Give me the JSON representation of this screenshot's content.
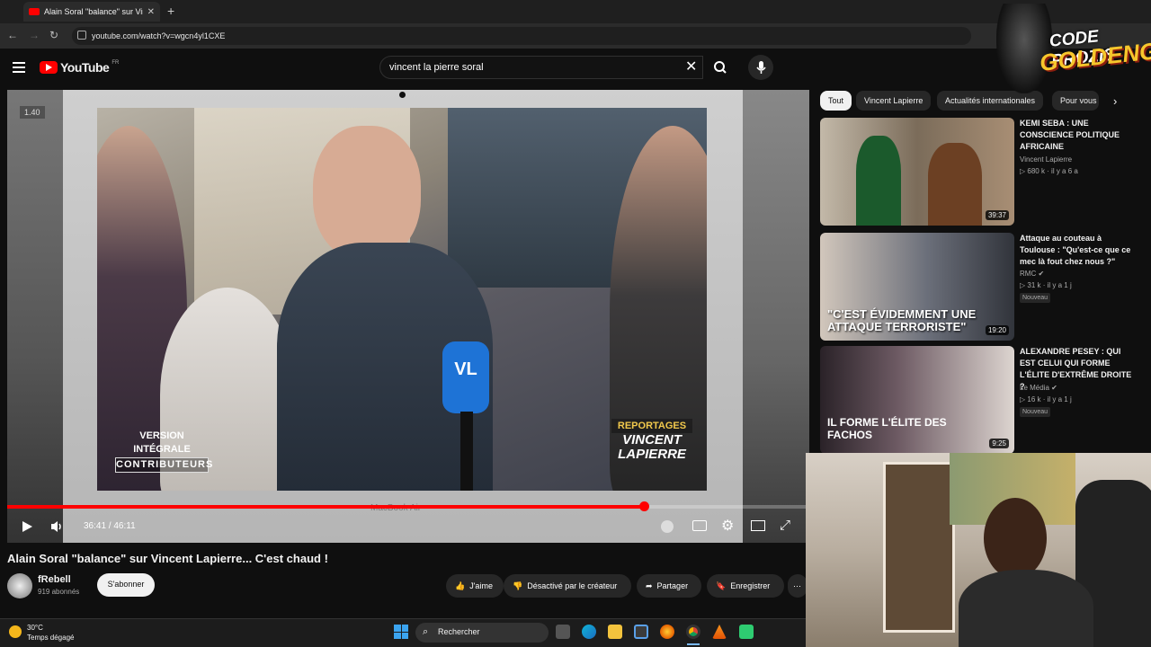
{
  "browser": {
    "tab_title": "Alain Soral \"balance\" sur Vincent Lapierre... C'est chaud ! - YouTube",
    "url": "youtube.com/watch?v=wgcn4yl1CXE"
  },
  "youtube": {
    "logo_text": "YouTube",
    "country": "FR",
    "search_value": "vincent la pierre soral"
  },
  "player": {
    "speed_label": "1.40",
    "time": "36:41 / 46:11",
    "progress": 0.794,
    "overlay_left_1": "VERSION INTÉGRALE",
    "overlay_left_2": "CONTRIBUTEURS",
    "overlay_right_1": "REPORTAGES",
    "overlay_right_2": "VINCENT",
    "overlay_right_3": "LAPIERRE",
    "laptop_brand": "MacBook Air",
    "mic_logo": "VL"
  },
  "video": {
    "title": "Alain Soral \"balance\" sur Vincent Lapierre... C'est chaud !",
    "channel": "fRebell",
    "subscribers": "919 abonnés",
    "subscribe_label": "S'abonner",
    "like_label": "J'aime",
    "dislike_label": "Désactivé par le créateur",
    "share_label": "Partager",
    "save_label": "Enregistrer"
  },
  "chips": [
    "Tout",
    "Vincent Lapierre",
    "Actualités internationales",
    "Pour vous"
  ],
  "recommendations": [
    {
      "title": "KEMI SEBA : UNE CONSCIENCE POLITIQUE AFRICAINE",
      "channel": "Vincent Lapierre",
      "meta": "680 k · il y a 6 a",
      "duration": "39:37",
      "badge": "",
      "thumb_text": ""
    },
    {
      "title": "Attaque au couteau à Toulouse : \"Qu'est-ce que ce mec là fout chez nous ?\"",
      "channel": "RMC",
      "meta": "31 k · il y a 1 j",
      "duration": "19:20",
      "badge": "Nouveau",
      "thumb_text": "\"C'EST ÉVIDEMMENT UNE ATTAQUE TERRORISTE\""
    },
    {
      "title": "ALEXANDRE PESEY : QUI EST CELUI QUI FORME L'ÉLITE D'EXTRÊME DROITE ?",
      "channel": "Le Média",
      "meta": "16 k · il y a 1 j",
      "duration": "9:25",
      "badge": "Nouveau",
      "thumb_text": "IL FORME L'ÉLITE DES FACHOS"
    }
  ],
  "overlay_logo": {
    "line1": "CODE PROZIS",
    "line2": "GOLDENG"
  },
  "taskbar": {
    "temperature": "30°C",
    "weather": "Temps dégagé",
    "search_label": "Rechercher"
  },
  "colors": {
    "accent": "#ff0000",
    "background": "#0f0f0f",
    "chip_active": "#f1f1f1"
  }
}
